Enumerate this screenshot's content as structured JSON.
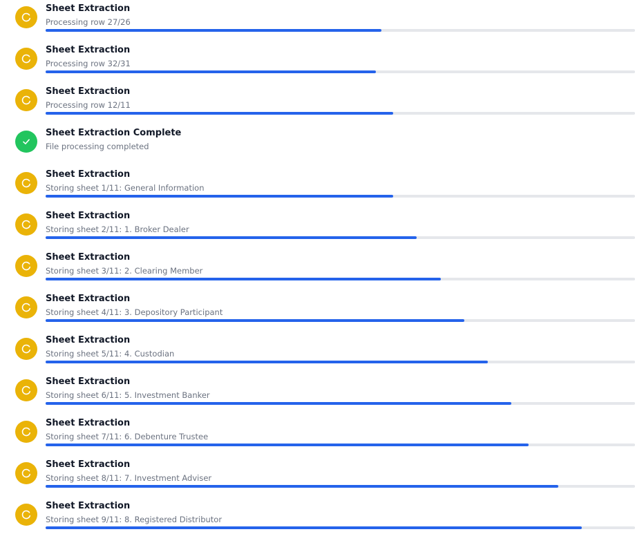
{
  "colors": {
    "in_progress_icon": "#eab308",
    "complete_icon": "#22c55e",
    "progress_fill": "#2563eb",
    "progress_track": "#e5e7eb"
  },
  "tasks": [
    {
      "status": "in-progress",
      "icon": "spinner-icon",
      "title": "Sheet Extraction",
      "subtitle": "Processing row 27/26",
      "progress": 0.57
    },
    {
      "status": "in-progress",
      "icon": "spinner-icon",
      "title": "Sheet Extraction",
      "subtitle": "Processing row 32/31",
      "progress": 0.56
    },
    {
      "status": "in-progress",
      "icon": "spinner-icon",
      "title": "Sheet Extraction",
      "subtitle": "Processing row 12/11",
      "progress": 0.59
    },
    {
      "status": "complete",
      "icon": "check-icon",
      "title": "Sheet Extraction Complete",
      "subtitle": "File processing completed",
      "progress": null
    },
    {
      "status": "in-progress",
      "icon": "spinner-icon",
      "title": "Sheet Extraction",
      "subtitle": "Storing sheet 1/11: General Information",
      "progress": 0.59
    },
    {
      "status": "in-progress",
      "icon": "spinner-icon",
      "title": "Sheet Extraction",
      "subtitle": "Storing sheet 2/11: 1. Broker Dealer",
      "progress": 0.63
    },
    {
      "status": "in-progress",
      "icon": "spinner-icon",
      "title": "Sheet Extraction",
      "subtitle": "Storing sheet 3/11: 2. Clearing Member",
      "progress": 0.67
    },
    {
      "status": "in-progress",
      "icon": "spinner-icon",
      "title": "Sheet Extraction",
      "subtitle": "Storing sheet 4/11: 3. Depository Participant",
      "progress": 0.71
    },
    {
      "status": "in-progress",
      "icon": "spinner-icon",
      "title": "Sheet Extraction",
      "subtitle": "Storing sheet 5/11: 4. Custodian",
      "progress": 0.75
    },
    {
      "status": "in-progress",
      "icon": "spinner-icon",
      "title": "Sheet Extraction",
      "subtitle": "Storing sheet 6/11: 5. Investment Banker",
      "progress": 0.79
    },
    {
      "status": "in-progress",
      "icon": "spinner-icon",
      "title": "Sheet Extraction",
      "subtitle": "Storing sheet 7/11: 6. Debenture Trustee",
      "progress": 0.82
    },
    {
      "status": "in-progress",
      "icon": "spinner-icon",
      "title": "Sheet Extraction",
      "subtitle": "Storing sheet 8/11: 7. Investment Adviser",
      "progress": 0.87
    },
    {
      "status": "in-progress",
      "icon": "spinner-icon",
      "title": "Sheet Extraction",
      "subtitle": "Storing sheet 9/11: 8. Registered Distributor",
      "progress": 0.91
    }
  ]
}
